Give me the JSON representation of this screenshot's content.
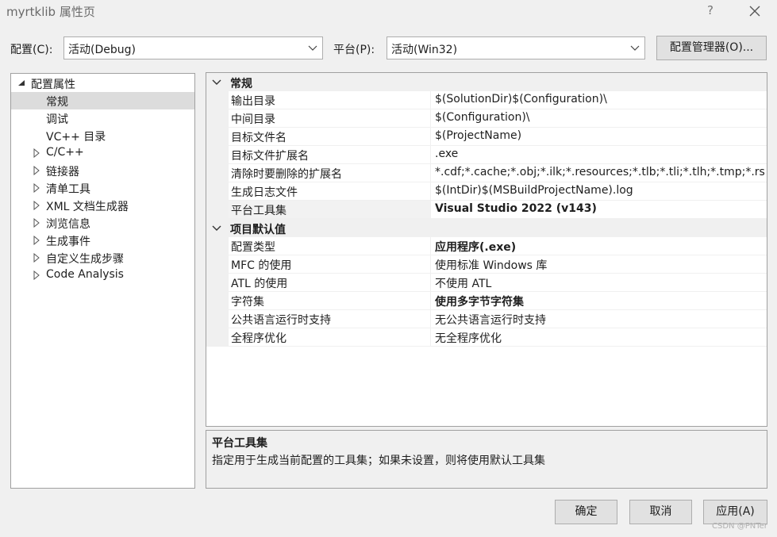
{
  "window": {
    "title": "myrtklib 属性页",
    "help_label": "?"
  },
  "toolbar": {
    "config_label": "配置(C):",
    "config_value": "活动(Debug)",
    "platform_label": "平台(P):",
    "platform_value": "活动(Win32)",
    "config_manager_label": "配置管理器(O)..."
  },
  "tree": {
    "root": "配置属性",
    "items": [
      {
        "label": "常规",
        "selected": true,
        "expandable": false
      },
      {
        "label": "调试",
        "expandable": false
      },
      {
        "label": "VC++ 目录",
        "expandable": false
      },
      {
        "label": "C/C++",
        "expandable": true
      },
      {
        "label": "链接器",
        "expandable": true
      },
      {
        "label": "清单工具",
        "expandable": true
      },
      {
        "label": "XML 文档生成器",
        "expandable": true
      },
      {
        "label": "浏览信息",
        "expandable": true
      },
      {
        "label": "生成事件",
        "expandable": true
      },
      {
        "label": "自定义生成步骤",
        "expandable": true
      },
      {
        "label": "Code Analysis",
        "expandable": true
      }
    ]
  },
  "grid": {
    "categories": [
      {
        "title": "常规",
        "rows": [
          {
            "name": "输出目录",
            "value": "$(SolutionDir)$(Configuration)\\"
          },
          {
            "name": "中间目录",
            "value": "$(Configuration)\\"
          },
          {
            "name": "目标文件名",
            "value": "$(ProjectName)"
          },
          {
            "name": "目标文件扩展名",
            "value": ".exe"
          },
          {
            "name": "清除时要删除的扩展名",
            "value": "*.cdf;*.cache;*.obj;*.ilk;*.resources;*.tlb;*.tli;*.tlh;*.tmp;*.rs"
          },
          {
            "name": "生成日志文件",
            "value": "$(IntDir)$(MSBuildProjectName).log"
          },
          {
            "name": "平台工具集",
            "value": "Visual Studio 2022 (v143)",
            "bold": true,
            "selected": true
          }
        ]
      },
      {
        "title": "项目默认值",
        "rows": [
          {
            "name": "配置类型",
            "value": "应用程序(.exe)",
            "bold": true
          },
          {
            "name": "MFC 的使用",
            "value": "使用标准 Windows 库"
          },
          {
            "name": "ATL 的使用",
            "value": "不使用 ATL"
          },
          {
            "name": "字符集",
            "value": "使用多字节字符集",
            "bold": true
          },
          {
            "name": "公共语言运行时支持",
            "value": "无公共语言运行时支持"
          },
          {
            "name": "全程序优化",
            "value": "无全程序优化"
          }
        ]
      }
    ]
  },
  "description": {
    "title": "平台工具集",
    "text": "指定用于生成当前配置的工具集；如果未设置，则将使用默认工具集"
  },
  "buttons": {
    "ok": "确定",
    "cancel": "取消",
    "apply": "应用(A)"
  },
  "watermark": "CSDN @PNTer",
  "colors": {
    "background": "#f0f0f0",
    "selection": "#dcdcdc",
    "border": "#a0a0a0"
  }
}
